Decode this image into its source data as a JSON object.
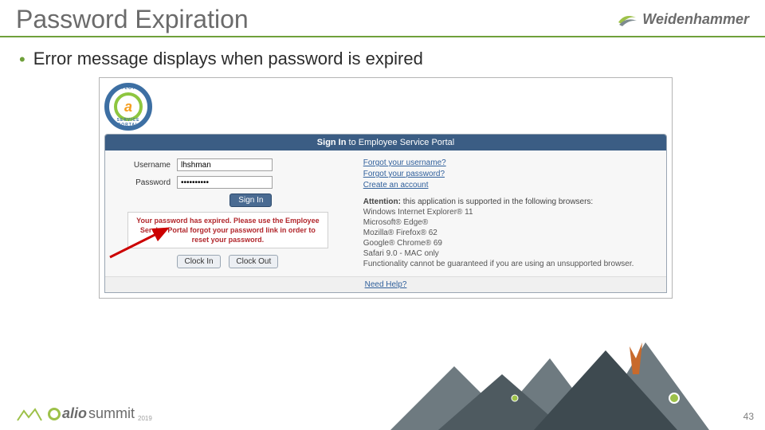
{
  "header": {
    "title": "Password Expiration",
    "brand": "Weidenhammer"
  },
  "bullet": {
    "text": "Error message displays when password is expired"
  },
  "screenshot": {
    "logo_top": "EMPLOYEE",
    "logo_bottom": "SERVICE PORTAL",
    "logo_letter": "a",
    "panel_title_bold": "Sign In",
    "panel_title_rest": " to Employee Service Portal",
    "form": {
      "username_label": "Username",
      "username_value": "lhshman",
      "password_label": "Password",
      "password_value": "••••••••••",
      "signin": "Sign In",
      "clock_in": "Clock In",
      "clock_out": "Clock Out"
    },
    "error": "Your password has expired. Please use the Employee Service Portal forgot your password link in order to reset your password.",
    "links": {
      "forgot_user": "Forgot your username?",
      "forgot_pass": "Forgot your password?",
      "create": "Create an account"
    },
    "attention": {
      "label": "Attention:",
      "text": " this application is supported in the following browsers:",
      "browsers": [
        "Windows Internet Explorer® 11",
        "Microsoft® Edge®",
        "Mozilla® Firefox® 62",
        "Google® Chrome® 69",
        "Safari 9.0 - MAC only"
      ],
      "footer": "Functionality cannot be guaranteed if you are using an unsupported browser."
    },
    "need_help": "Need Help?"
  },
  "footer": {
    "alio": "alio",
    "summit": "summit",
    "year": "2019",
    "page": "43"
  }
}
